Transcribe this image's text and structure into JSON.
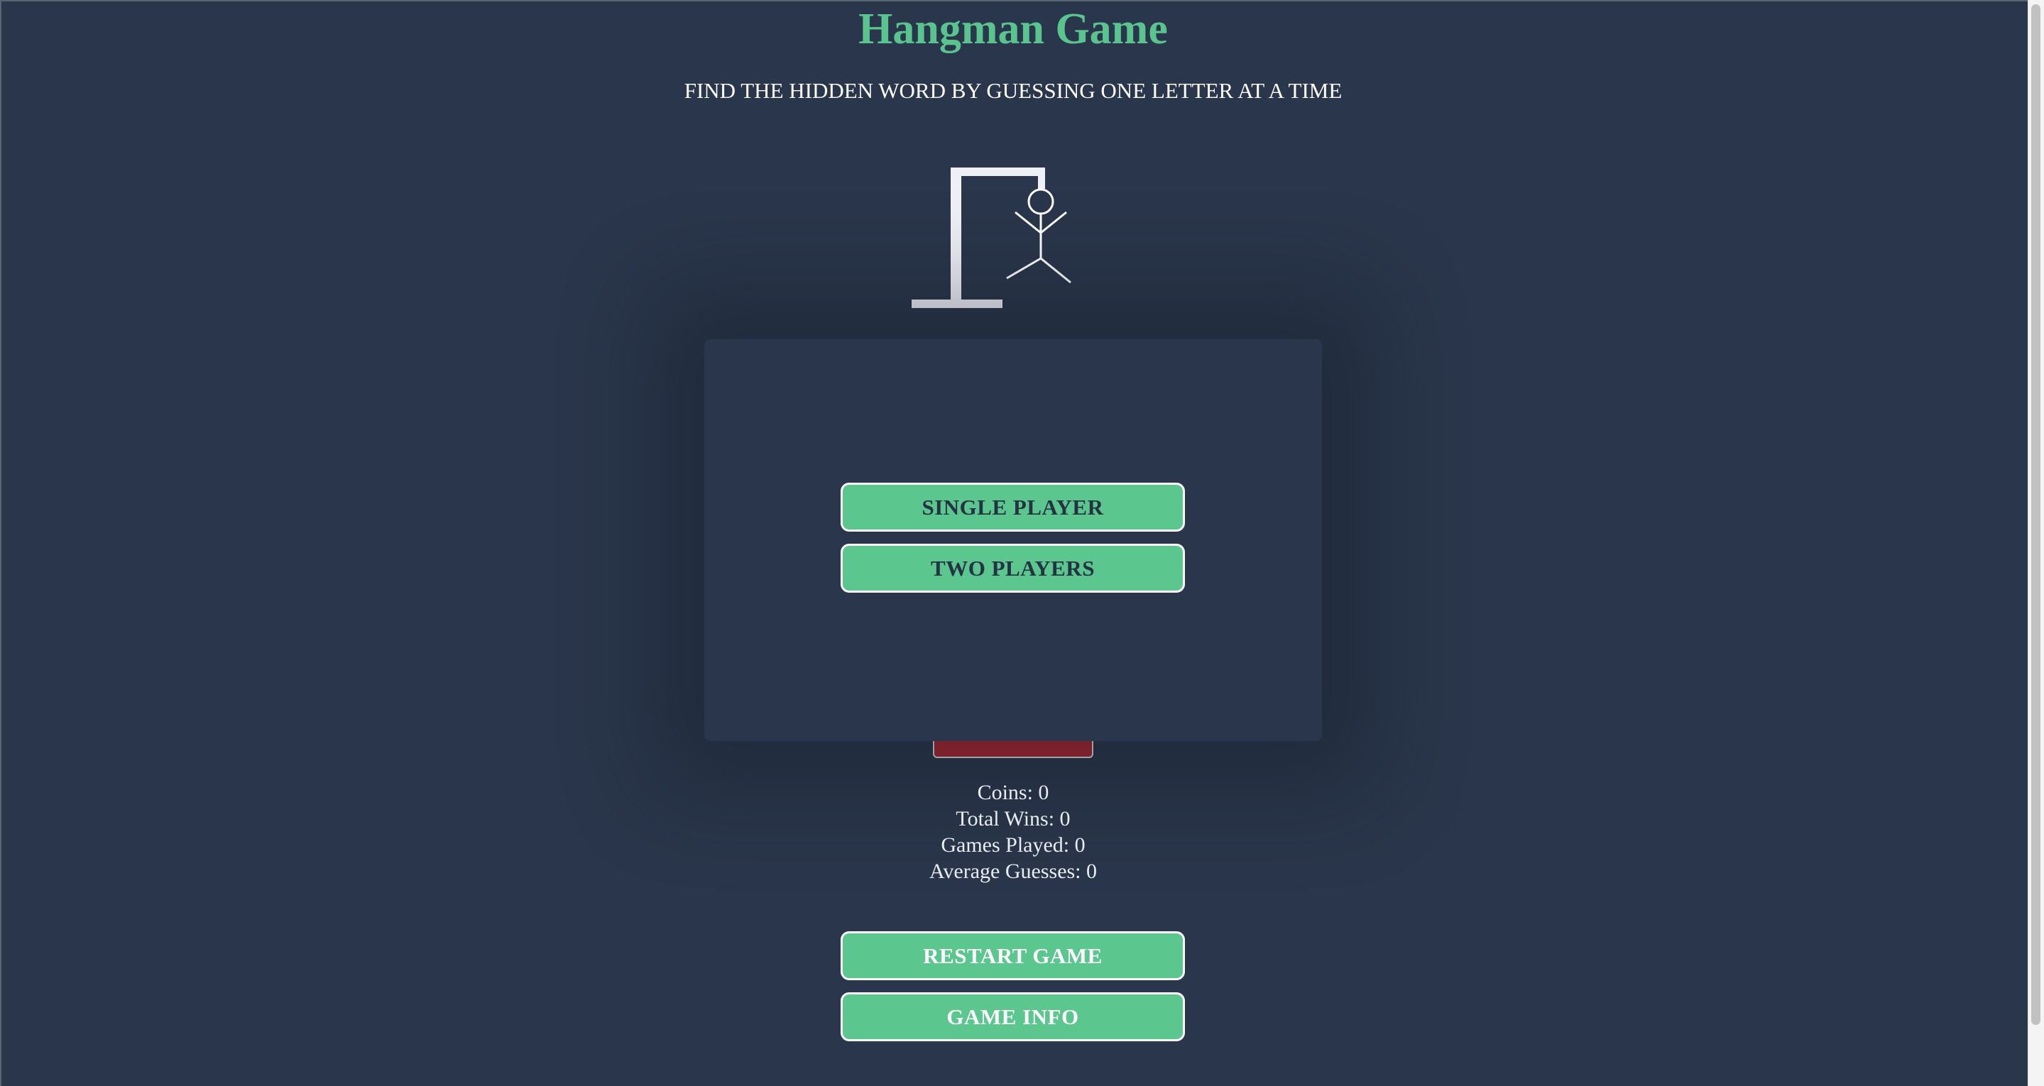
{
  "header": {
    "title": "Hangman Game",
    "subtitle": "FIND THE HIDDEN WORD BY GUESSING ONE LETTER AT A TIME"
  },
  "mode_menu": {
    "single_player_label": "SINGLE PLAYER",
    "two_players_label": "TWO PLAYERS"
  },
  "stats": {
    "coins": "Coins: 0",
    "total_wins": "Total Wins: 0",
    "games_played": "Games Played: 0",
    "average_guesses": "Average Guesses: 0"
  },
  "actions": {
    "restart_label": "RESTART GAME",
    "info_label": "GAME INFO"
  },
  "colors": {
    "background": "#2a364b",
    "accent": "#5bc68d",
    "danger": "#a52631"
  },
  "icons": {
    "hangman_figure": "hangman-gallows-icon"
  }
}
